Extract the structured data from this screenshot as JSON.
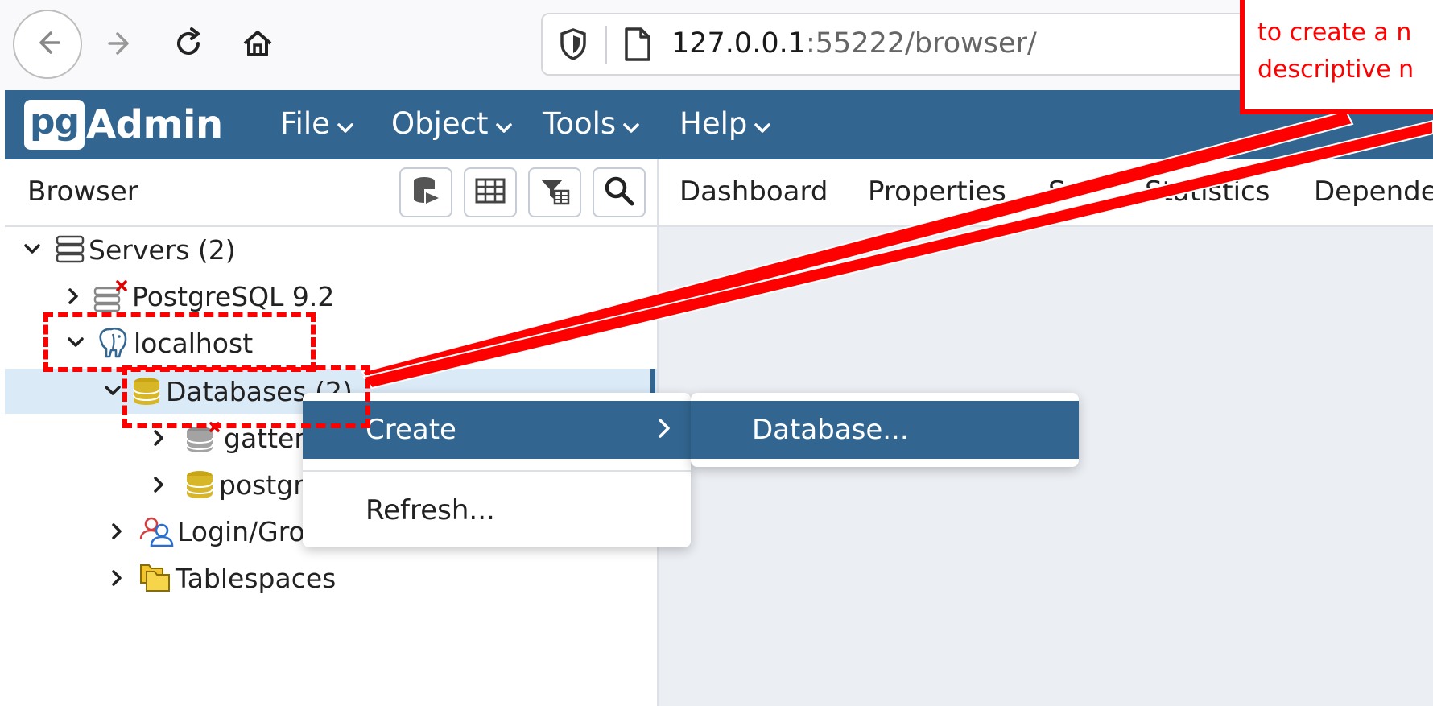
{
  "browser": {
    "url_host": "127.0.0.1",
    "url_rest": ":55222/browser/"
  },
  "app": {
    "logo_pg": "pg",
    "logo_admin": "Admin",
    "menus": [
      "File",
      "Object",
      "Tools",
      "Help"
    ]
  },
  "browser_panel": {
    "title": "Browser",
    "tree": {
      "servers": "Servers (2)",
      "postgresql": "PostgreSQL 9.2",
      "localhost": "localhost",
      "databases": "Databases (2)",
      "gatter": "gatter",
      "postgres": "postgr",
      "login_roles": "Login/Gro",
      "tablespaces": "Tablespaces"
    }
  },
  "tabs": [
    "Dashboard",
    "Properties",
    "S",
    "Statistics",
    "Depende"
  ],
  "context_menu": {
    "create": "Create",
    "refresh": "Refresh...",
    "submenu_database": "Database..."
  },
  "annotation": {
    "line1": "to create a n",
    "line2": "descriptive n",
    "color": "#ff0000"
  },
  "colors": {
    "accent": "#326690",
    "selection": "#dbeaf7"
  }
}
